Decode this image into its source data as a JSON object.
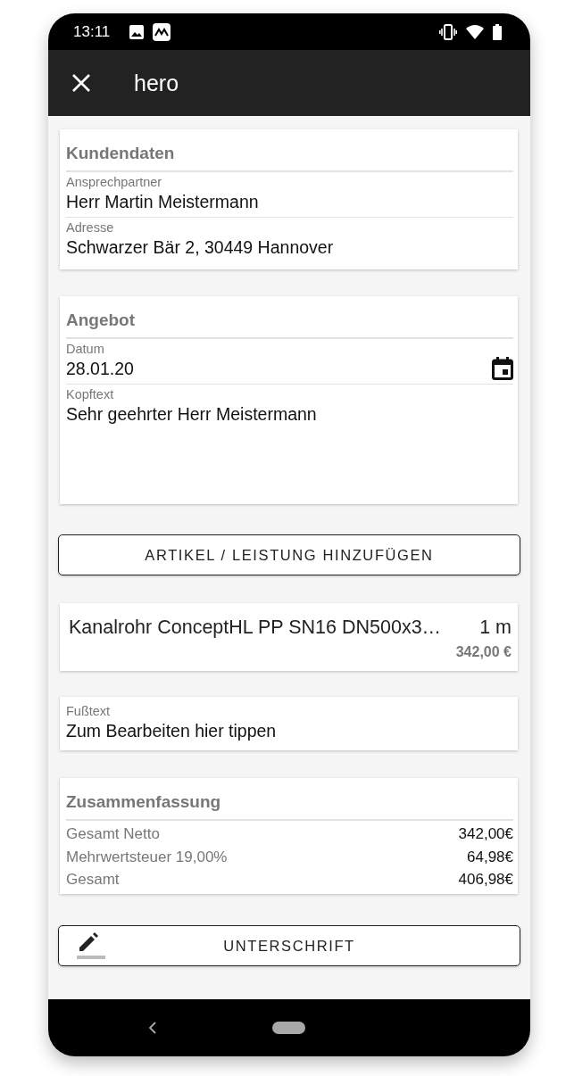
{
  "status_bar": {
    "time": "13:11"
  },
  "app_bar": {
    "title": "hero"
  },
  "customer_section": {
    "title": "Kundendaten",
    "fields": [
      {
        "label": "Ansprechpartner",
        "value": "Herr Martin Meistermann",
        "kind": "text"
      },
      {
        "label": "Adresse",
        "value": "Schwarzer Bär 2, 30449 Hannover",
        "kind": "text"
      }
    ]
  },
  "offer_section": {
    "title": "Angebot",
    "fields": [
      {
        "label": "Datum",
        "value": "28.01.20",
        "kind": "date"
      },
      {
        "label": "Kopftext",
        "value": "Sehr geehrter Herr Meistermann",
        "kind": "multiline"
      }
    ]
  },
  "add_button": {
    "label": "ARTIKEL / LEISTUNG HINZUFÜGEN"
  },
  "line_items": [
    {
      "name": "Kanalrohr ConceptHL PP SN16 DN500x3…",
      "quantity": "1 m",
      "price": "342,00 €"
    }
  ],
  "footer_text": {
    "label": "Fußtext",
    "value": "Zum Bearbeiten hier tippen"
  },
  "summary": {
    "title": "Zusammenfassung",
    "rows": [
      {
        "label": "Gesamt Netto",
        "value": "342,00€"
      },
      {
        "label": "Mehrwertsteuer 19,00%",
        "value": "64,98€"
      },
      {
        "label": "Gesamt",
        "value": "406,98€"
      }
    ]
  },
  "signature_button": {
    "label": "UNTERSCHRIFT"
  }
}
